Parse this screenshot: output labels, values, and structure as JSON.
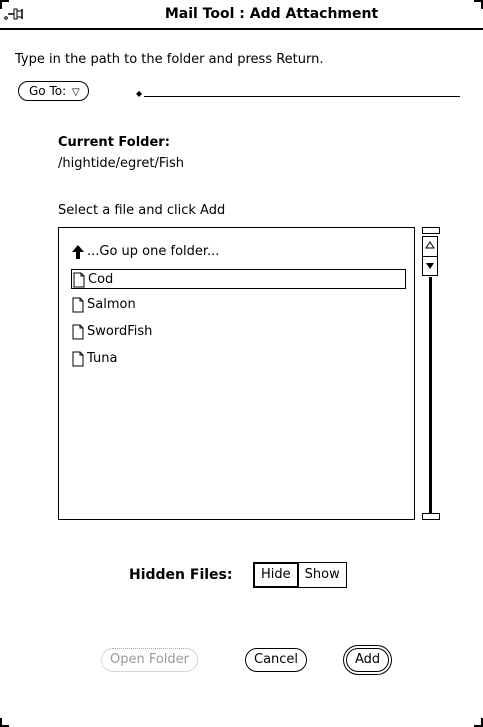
{
  "window": {
    "title": "Mail Tool : Add Attachment"
  },
  "path_bar": {
    "instruction": "Type in the path to the folder and press Return.",
    "goto_label": "Go To:",
    "goto_glyph": "▽",
    "input_value": ""
  },
  "folder": {
    "label": "Current Folder:",
    "path": "/hightide/egret/Fish"
  },
  "file_list": {
    "prompt": "Select a file and click Add",
    "up_item": "...Go up one folder...",
    "items": [
      {
        "label": "Cod",
        "icon": "document-icon",
        "selected": true
      },
      {
        "label": "Salmon",
        "icon": "document-icon",
        "selected": false
      },
      {
        "label": "SwordFish",
        "icon": "document-icon",
        "selected": false
      },
      {
        "label": "Tuna",
        "icon": "document-icon",
        "selected": false
      }
    ]
  },
  "hidden_files": {
    "label": "Hidden Files:",
    "options": [
      "Hide",
      "Show"
    ],
    "selected": "Hide"
  },
  "buttons": {
    "open_folder": "Open Folder",
    "cancel": "Cancel",
    "add": "Add"
  }
}
